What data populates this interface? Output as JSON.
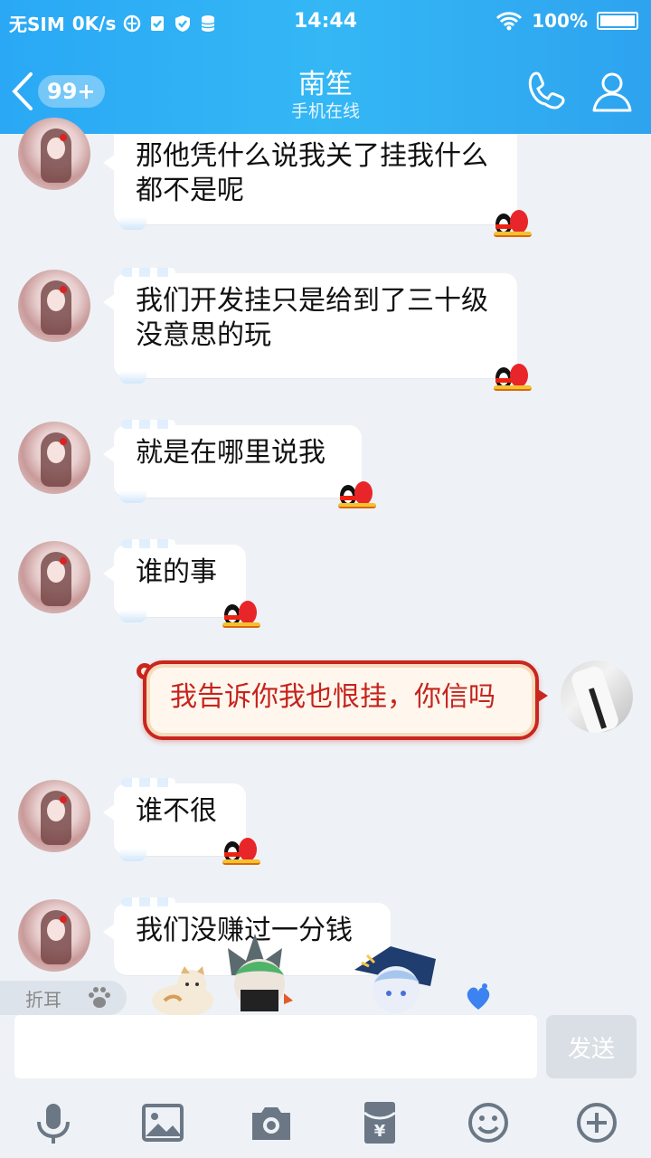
{
  "status_bar": {
    "carrier": "无SIM",
    "speed": "0K/s",
    "time": "14:44",
    "battery": "100%"
  },
  "header": {
    "back_badge": "99+",
    "title": "南笙",
    "subtitle": "手机在线"
  },
  "messages": [
    {
      "from": "other",
      "text": "那他凭什么说我关了挂我什么都不是呢"
    },
    {
      "from": "other",
      "text": "我们开发挂只是给到了三十级没意思的玩"
    },
    {
      "from": "other",
      "text": "就是在哪里说我"
    },
    {
      "from": "other",
      "text": "谁的事"
    },
    {
      "from": "me",
      "text": "我告诉你我也恨挂，你信吗"
    },
    {
      "from": "other",
      "text": "谁不很"
    },
    {
      "from": "other",
      "text": "我们没赚过一分钱"
    }
  ],
  "ear_bar": {
    "label": "折耳"
  },
  "input": {
    "value": "",
    "placeholder": ""
  },
  "send_label": "发送",
  "colors": {
    "header": "#2aa8f5",
    "mine_border": "#c8261e",
    "mine_text": "#c5241c"
  },
  "toolbar_icons": [
    "mic-icon",
    "image-icon",
    "camera-icon",
    "red-packet-icon",
    "emoji-icon",
    "plus-icon"
  ]
}
